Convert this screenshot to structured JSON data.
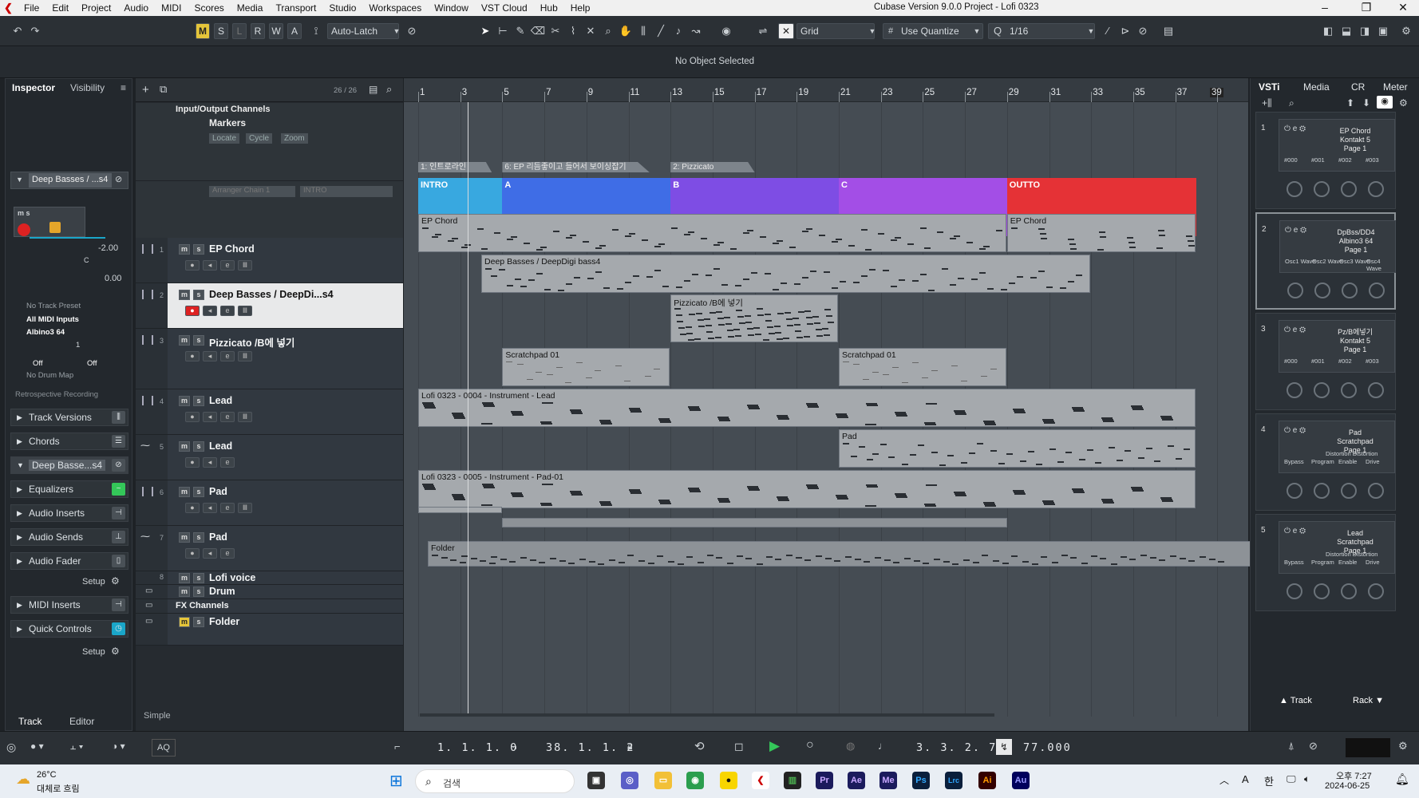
{
  "menu": [
    "File",
    "Edit",
    "Project",
    "Audio",
    "MIDI",
    "Scores",
    "Media",
    "Transport",
    "Studio",
    "Workspaces",
    "Window",
    "VST Cloud",
    "Hub",
    "Help"
  ],
  "window_title": "Cubase Version 9.0.0 Project - Lofi 0323",
  "toolbar": {
    "buttons_mode": [
      "M",
      "S",
      "L",
      "R",
      "W",
      "A"
    ],
    "automation_mode": "Auto-Latch",
    "snap_type": "Grid",
    "quantize_mode": "Use Quantize",
    "quantize_value": "1/16"
  },
  "info_line": "No Object Selected",
  "inspector": {
    "tabs": [
      "Inspector",
      "Visibility"
    ],
    "track_name": "Deep Basses / ...s4",
    "volume": "-2.00",
    "pan": "C",
    "pan_value": "0.00",
    "no_track_preset": "No Track Preset",
    "midi_input": "All MIDI Inputs",
    "midi_output": "Albino3 64",
    "channel": "1",
    "off1": "Off",
    "off2": "Off",
    "no_drum_map": "No Drum Map",
    "retro": "Retrospective Recording",
    "sections": [
      "Track Versions",
      "Chords",
      "Deep Basse...s4",
      "Equalizers",
      "Audio Inserts",
      "Audio Sends",
      "Audio Fader",
      "MIDI Inserts",
      "Quick Controls"
    ],
    "setup": "Setup",
    "bottom_tabs": [
      "Track",
      "Editor"
    ]
  },
  "tracklist": {
    "count": "26 / 26",
    "io_channels": "Input/Output Channels",
    "markers": "Markers",
    "marker_buttons": [
      "Locate",
      "Cycle",
      "Zoom"
    ],
    "arranger_chain": "Arranger Chain 1",
    "arranger_intro": "INTRO",
    "tracks": [
      {
        "num": "1",
        "name": "EP Chord"
      },
      {
        "num": "2",
        "name": "Deep Basses / DeepDi...s4"
      },
      {
        "num": "3",
        "name": "Pizzicato /B에 넣기"
      },
      {
        "num": "4",
        "name": "Lead"
      },
      {
        "num": "5",
        "name": "Lead"
      },
      {
        "num": "6",
        "name": "Pad"
      },
      {
        "num": "7",
        "name": "Pad"
      },
      {
        "num": "8",
        "name": "Lofi voice"
      },
      {
        "num": "",
        "name": "Drum"
      },
      {
        "num": "",
        "name": "FX Channels"
      },
      {
        "num": "",
        "name": "Folder"
      }
    ],
    "footer": "Simple"
  },
  "ruler": [
    "1",
    "3",
    "5",
    "7",
    "9",
    "11",
    "13",
    "15",
    "17",
    "19",
    "21",
    "23",
    "25",
    "27",
    "29",
    "31",
    "33",
    "35",
    "37",
    "39"
  ],
  "markers": [
    "1: 인트로라인",
    "6: EP 리듬좋이고 들어서 보이싱잡기",
    "2: Pizzicato"
  ],
  "arranger": [
    "INTRO",
    "A",
    "B",
    "C",
    "OUTTO"
  ],
  "parts": {
    "ep1": "EP Chord",
    "ep2": "EP Chord",
    "bass": "Deep Basses / DeepDigi bass4",
    "pizz": "Pizzicato /B에 넣기",
    "lead1": "Scratchpad 01",
    "lead2": "Scratchpad 01",
    "leadaudio": "Lofi 0323 - 0004 - Instrument - Lead",
    "pad": "Pad",
    "padaudio": "Lofi 0323 - 0005 - Instrument - Pad-01",
    "folder": "Folder"
  },
  "rightzone": {
    "tabs": [
      "VSTi",
      "Media",
      "CR",
      "Meter"
    ],
    "slots": [
      {
        "n": "1",
        "name": "EP Chord\nKontakt 5\nPage 1",
        "labels": [
          "#000",
          "#001",
          "#002",
          "#003"
        ]
      },
      {
        "n": "2",
        "name": "DpBss/DD4\nAlbino3 64\nPage 1",
        "labels": [
          "Osc1 Wave",
          "Osc2 Wave",
          "Osc3 Wave",
          "Osc4 Wave"
        ]
      },
      {
        "n": "3",
        "name": "Pz/B에넣기\nKontakt 5\nPage 1",
        "labels": [
          "#000",
          "#001",
          "#002",
          "#003"
        ]
      },
      {
        "n": "4",
        "name": "Pad\nScratchpad\nPage 1",
        "labels": [
          "Bypass",
          "Program",
          "Enable",
          "Drive"
        ]
      },
      {
        "n": "5",
        "name": "Lead\nScratchpad\nPage 1",
        "labels": [
          "Bypass",
          "Program",
          "Enable",
          "Drive"
        ]
      }
    ],
    "distortion": "Distortion Distortion",
    "footer_track": "Track",
    "footer_rack": "Rack"
  },
  "transport": {
    "left_locator": "1. 1. 1.   0",
    "right_locator": "38. 1. 1.   2",
    "position": "3. 3. 2. 73",
    "tempo": "77.000",
    "aq": "AQ"
  },
  "taskbar": {
    "weather_temp": "26°C",
    "weather_text": "대체로 흐림",
    "search": "검색",
    "time": "오후 7:27",
    "date": "2024-06-25",
    "lang": "한",
    "lang2": "A",
    "apps": [
      "Pr",
      "Ae",
      "Me",
      "Ps",
      "Lrc",
      "Ai",
      "Au"
    ]
  },
  "colors": {
    "intro": "#38a8e0",
    "A": "#3f6de6",
    "B": "#7e4de4",
    "C": "#a34ee6",
    "outto": "#e53236",
    "selected_track": "#e8e9ea"
  }
}
